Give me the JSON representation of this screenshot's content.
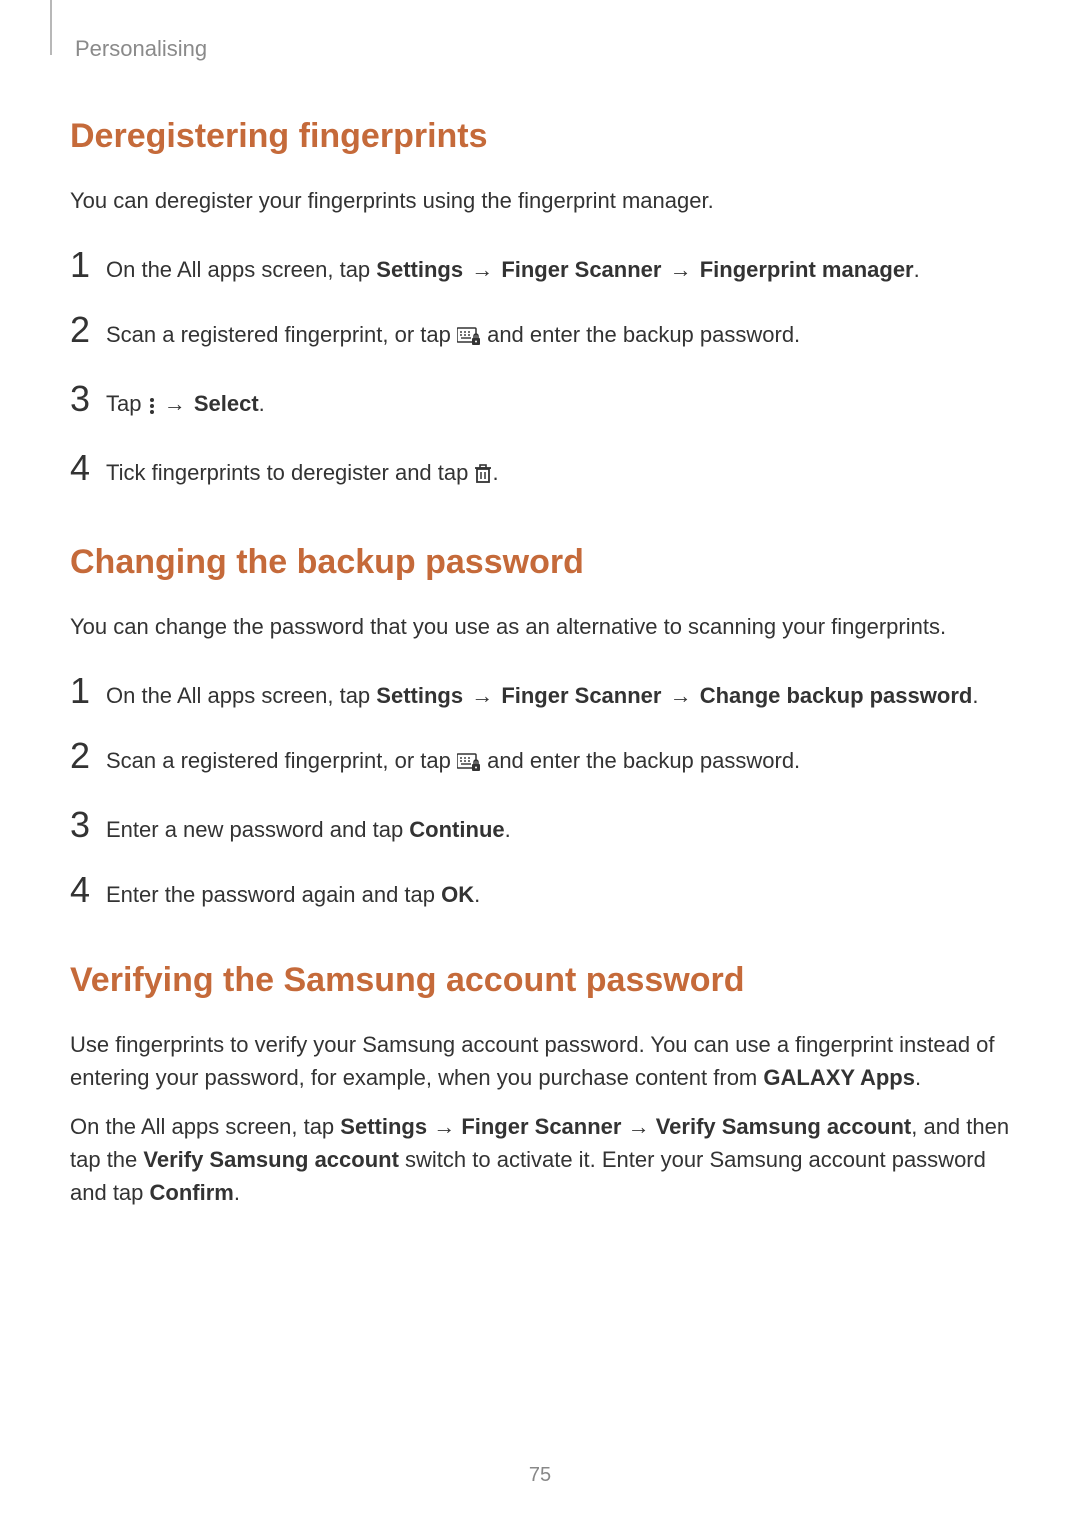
{
  "header": {
    "chapter": "Personalising"
  },
  "sections": [
    {
      "heading": "Deregistering fingerprints",
      "intro": "You can deregister your fingerprints using the fingerprint manager.",
      "steps": [
        {
          "num": "1",
          "pre": "On the All apps screen, tap ",
          "bold1": "Settings",
          "arrow1": " → ",
          "bold2": "Finger Scanner",
          "arrow2": " → ",
          "bold3": "Fingerprint manager",
          "post": "."
        },
        {
          "num": "2",
          "pre": "Scan a registered fingerprint, or tap ",
          "icon": "keyboard-lock-icon",
          "post": " and enter the backup password."
        },
        {
          "num": "3",
          "pre": "Tap ",
          "icon": "more-vert-icon",
          "arrow1": " → ",
          "bold1": "Select",
          "post": "."
        },
        {
          "num": "4",
          "pre": "Tick fingerprints to deregister and tap ",
          "icon": "trash-icon",
          "post": "."
        }
      ]
    },
    {
      "heading": "Changing the backup password",
      "intro": "You can change the password that you use as an alternative to scanning your fingerprints.",
      "steps": [
        {
          "num": "1",
          "pre": "On the All apps screen, tap ",
          "bold1": "Settings",
          "arrow1": " → ",
          "bold2": "Finger Scanner",
          "arrow2": " → ",
          "bold3": "Change backup password",
          "post": "."
        },
        {
          "num": "2",
          "pre": "Scan a registered fingerprint, or tap ",
          "icon": "keyboard-lock-icon",
          "post": " and enter the backup password."
        },
        {
          "num": "3",
          "pre": "Enter a new password and tap ",
          "bold1": "Continue",
          "post": "."
        },
        {
          "num": "4",
          "pre": "Enter the password again and tap ",
          "bold1": "OK",
          "post": "."
        }
      ]
    },
    {
      "heading": "Verifying the Samsung account password",
      "paragraphs": [
        {
          "runs": [
            {
              "t": "Use fingerprints to verify your Samsung account password. You can use a fingerprint instead of entering your password, for example, when you purchase content from "
            },
            {
              "t": "GALAXY Apps",
              "b": true
            },
            {
              "t": "."
            }
          ]
        },
        {
          "runs": [
            {
              "t": "On the All apps screen, tap "
            },
            {
              "t": "Settings",
              "b": true
            },
            {
              "t": " → "
            },
            {
              "t": "Finger Scanner",
              "b": true
            },
            {
              "t": " → "
            },
            {
              "t": "Verify Samsung account",
              "b": true
            },
            {
              "t": ", and then tap the "
            },
            {
              "t": "Verify Samsung account",
              "b": true
            },
            {
              "t": " switch to activate it. Enter your Samsung account password and tap "
            },
            {
              "t": "Confirm",
              "b": true
            },
            {
              "t": "."
            }
          ]
        }
      ]
    }
  ],
  "pageNumber": "75"
}
